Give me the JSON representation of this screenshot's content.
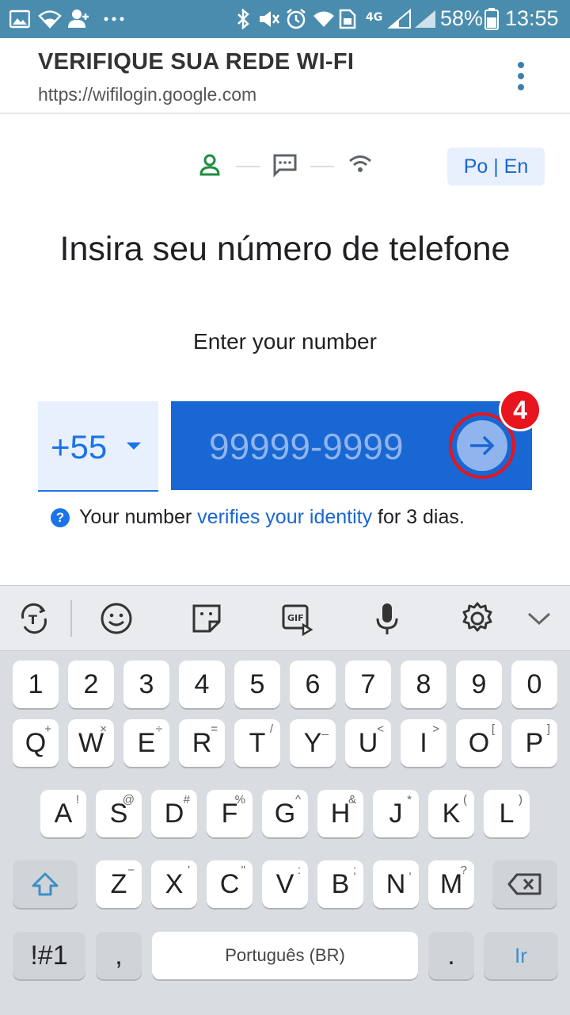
{
  "status_bar": {
    "battery_percent": "58%",
    "time": "13:55",
    "network_label": "4G",
    "icons": [
      "gallery-icon",
      "wifi-icon",
      "add-contact-icon",
      "more-dots-icon",
      "bluetooth-icon",
      "mute-icon",
      "alarm-icon",
      "wifi-icon",
      "data-sim-icon",
      "signal-icon",
      "signal-icon",
      "battery-icon"
    ]
  },
  "browser": {
    "title": "VERIFIQUE SUA REDE WI-FI",
    "url": "https://wifilogin.google.com"
  },
  "page": {
    "language_toggle": "Po | En",
    "heading": "Insira seu número de telefone",
    "subheading": "Enter your number",
    "country_code": "+55",
    "phone_placeholder": "99999-9999",
    "step_badge": "4",
    "note_prefix": "Your number ",
    "note_link": "verifies your identity",
    "note_suffix": " for 3 dias.",
    "accent_color": "#1967d2",
    "highlight_color": "#e8141e"
  },
  "keyboard": {
    "row_numbers": [
      "1",
      "2",
      "3",
      "4",
      "5",
      "6",
      "7",
      "8",
      "9",
      "0"
    ],
    "row_q": [
      {
        "k": "Q",
        "s": "+"
      },
      {
        "k": "W",
        "s": "×"
      },
      {
        "k": "E",
        "s": "÷"
      },
      {
        "k": "R",
        "s": "="
      },
      {
        "k": "T",
        "s": "/"
      },
      {
        "k": "Y",
        "s": "_"
      },
      {
        "k": "U",
        "s": "<"
      },
      {
        "k": "I",
        "s": ">"
      },
      {
        "k": "O",
        "s": "["
      },
      {
        "k": "P",
        "s": "]"
      }
    ],
    "row_a": [
      {
        "k": "A",
        "s": "!"
      },
      {
        "k": "S",
        "s": "@"
      },
      {
        "k": "D",
        "s": "#"
      },
      {
        "k": "F",
        "s": "%"
      },
      {
        "k": "G",
        "s": "^"
      },
      {
        "k": "H",
        "s": "&"
      },
      {
        "k": "J",
        "s": "*"
      },
      {
        "k": "K",
        "s": "("
      },
      {
        "k": "L",
        "s": ")"
      }
    ],
    "row_z": [
      {
        "k": "Z",
        "s": "−"
      },
      {
        "k": "X",
        "s": "'"
      },
      {
        "k": "C",
        "s": "\""
      },
      {
        "k": "V",
        "s": ":"
      },
      {
        "k": "B",
        "s": ";"
      },
      {
        "k": "N",
        "s": ","
      },
      {
        "k": "M",
        "s": "?"
      }
    ],
    "symbols_key": "!#1",
    "comma_key": ",",
    "space_label": "Português (BR)",
    "period_key": ".",
    "go_key": "Ir"
  }
}
